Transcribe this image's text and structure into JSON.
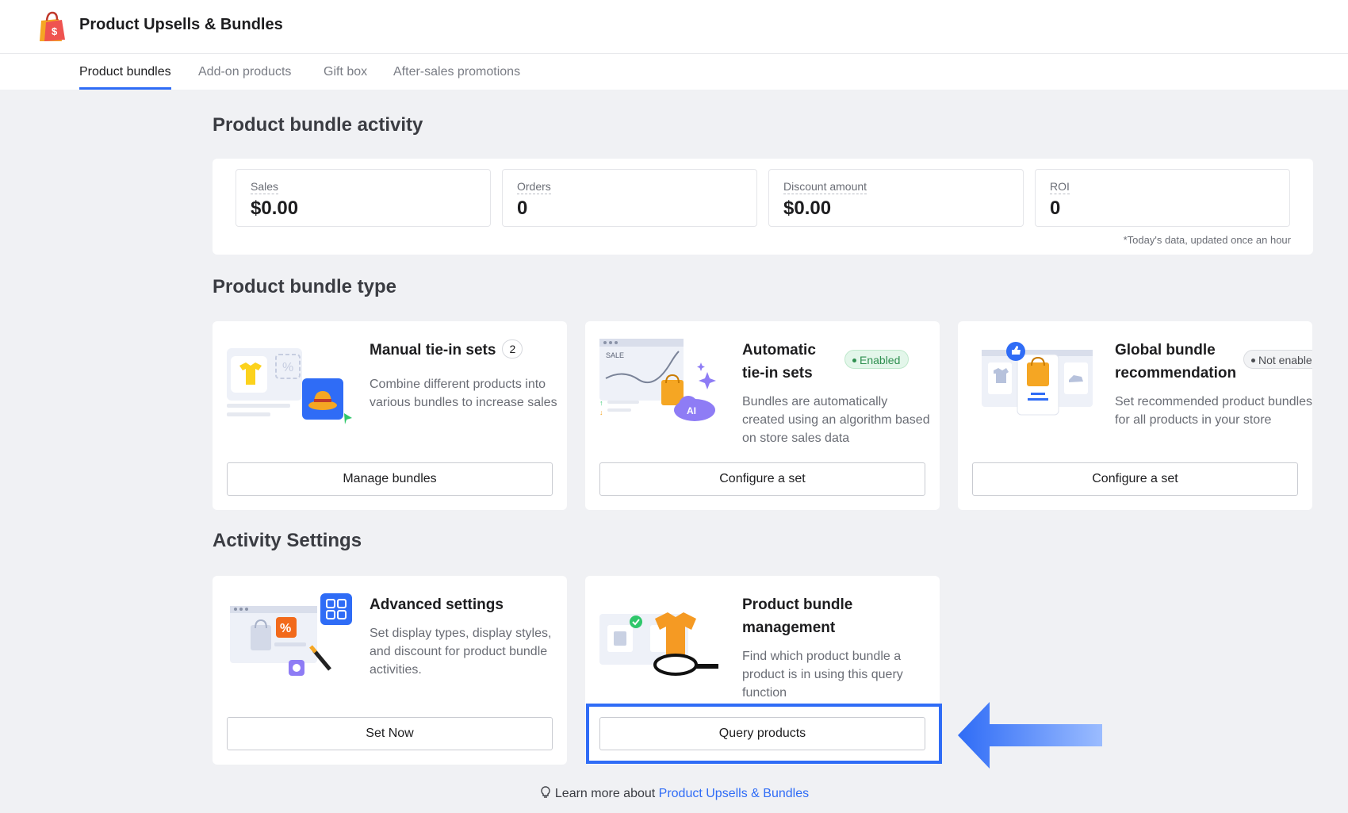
{
  "app": {
    "title": "Product Upsells & Bundles"
  },
  "tabs": [
    {
      "label": "Product bundles",
      "active": true
    },
    {
      "label": "Add-on products"
    },
    {
      "label": "Gift box"
    },
    {
      "label": "After-sales promotions"
    }
  ],
  "activity": {
    "title": "Product bundle activity",
    "stats": [
      {
        "label": "Sales",
        "value": "$0.00"
      },
      {
        "label": "Orders",
        "value": "0"
      },
      {
        "label": "Discount amount",
        "value": "$0.00"
      },
      {
        "label": "ROI",
        "value": "0"
      }
    ],
    "note": "*Today's data, updated once an hour"
  },
  "bundle_type": {
    "title": "Product bundle type",
    "cards": [
      {
        "title": "Manual tie-in sets",
        "count": "2",
        "desc": "Combine different products into various bundles to increase sales",
        "button": "Manage bundles",
        "illustration": "shirt-hat-icon"
      },
      {
        "title": "Automatic tie-in sets",
        "status": "Enabled",
        "desc": "Bundles are automatically created using an algorithm based on store sales data",
        "button": "Configure a set",
        "illustration": "sales-chart-ai-icon"
      },
      {
        "title": "Global bundle recommendation",
        "status": "Not enabled",
        "desc": "Set recommended product bundles for all products in your store",
        "button": "Configure a set",
        "illustration": "recommend-bag-icon"
      }
    ]
  },
  "settings": {
    "title": "Activity Settings",
    "cards": [
      {
        "title": "Advanced settings",
        "desc": "Set display types, display styles, and discount for product bundle activities.",
        "button": "Set Now",
        "illustration": "settings-wand-icon"
      },
      {
        "title": "Product bundle management",
        "desc": "Find which product bundle a product is in using this query function",
        "button": "Query products",
        "illustration": "magnifier-shirt-icon"
      }
    ]
  },
  "footer": {
    "prefix": "Learn more about ",
    "link": "Product Upsells & Bundles"
  },
  "colors": {
    "accent": "#2f6cf6",
    "enabled": "#2f8f50",
    "background": "#f0f1f4"
  }
}
